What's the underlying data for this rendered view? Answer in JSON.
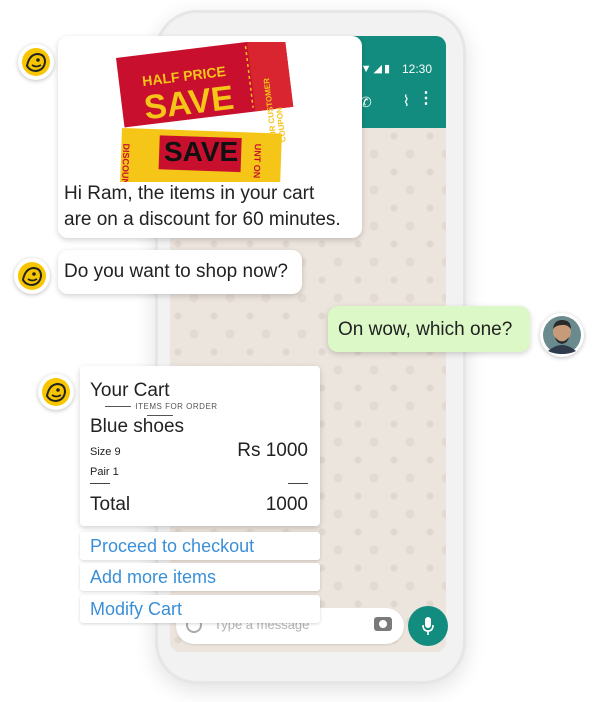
{
  "status_bar": {
    "time": "12:30"
  },
  "input_bar": {
    "placeholder": "Type a message"
  },
  "coupons": {
    "top_line": "HALF PRICE",
    "big_word": "SAVE",
    "side_text": "OUR CUSTOMER COUPON",
    "second_word": "SAVE",
    "second_side_left": "DISCOUNT",
    "second_side_right": "UNT ON"
  },
  "messages": {
    "discount_line1": "Hi Ram, the items in your cart",
    "discount_line2": "are on a discount for 60 minutes.",
    "shop_now": "Do you want to shop now?",
    "user_reply": "On wow, which one?"
  },
  "cart": {
    "title": "Your Cart",
    "subtitle": "ITEMS FOR ORDER",
    "product_name": "Blue shoes",
    "size": "Size 9",
    "pair": "Pair 1",
    "price": "Rs 1000",
    "total_label": "Total",
    "total_value": "1000"
  },
  "actions": {
    "checkout": "Proceed to checkout",
    "add_items": "Add more items",
    "modify_cart": "Modify Cart"
  },
  "colors": {
    "whatsapp_green": "#128c7e",
    "user_bubble": "#dcf8c6",
    "link_blue": "#3a8fd8",
    "coupon_red": "#c8102e",
    "coupon_yellow": "#f5c518"
  }
}
